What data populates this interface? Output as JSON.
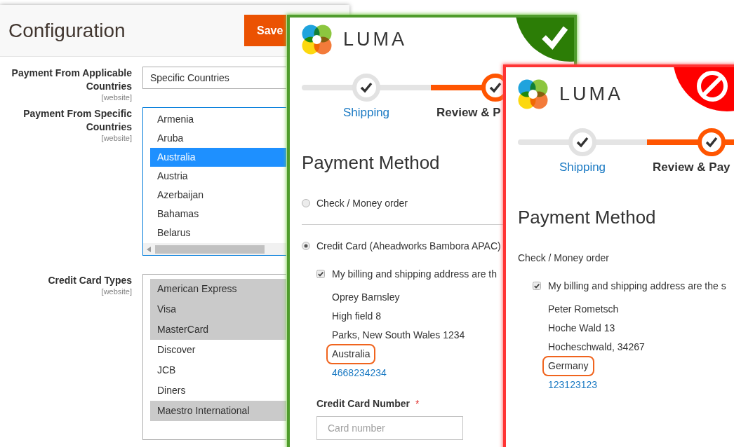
{
  "admin": {
    "title": "Configuration",
    "save_label": "Save",
    "fields": [
      {
        "kind": "select",
        "label": "Payment From Applicable Countries",
        "scope": "[website]",
        "value": "Specific Countries"
      },
      {
        "kind": "multiselect",
        "label": "Payment From Specific Countries",
        "scope": "[website]",
        "focused": true,
        "horizontal_scrollbar": true,
        "options": [
          {
            "label": "Armenia",
            "selected": false
          },
          {
            "label": "Aruba",
            "selected": false
          },
          {
            "label": "Australia",
            "selected": true
          },
          {
            "label": "Austria",
            "selected": false
          },
          {
            "label": "Azerbaijan",
            "selected": false
          },
          {
            "label": "Bahamas",
            "selected": false
          },
          {
            "label": "Belarus",
            "selected": false
          }
        ]
      },
      {
        "kind": "multiselect",
        "label": "Credit Card Types",
        "scope": "[website]",
        "focused": false,
        "options": [
          {
            "label": "American Express",
            "selected": true
          },
          {
            "label": "Visa",
            "selected": true
          },
          {
            "label": "MasterCard",
            "selected": true
          },
          {
            "label": "Discover",
            "selected": false
          },
          {
            "label": "JCB",
            "selected": false
          },
          {
            "label": "Diners",
            "selected": false
          },
          {
            "label": "Maestro International",
            "selected": true
          }
        ]
      }
    ]
  },
  "checkouts": [
    {
      "kind": "accepted",
      "brand": "LUMA",
      "steps": [
        {
          "label": "Shipping",
          "current": false
        },
        {
          "label": "Review & P",
          "current": true
        }
      ],
      "heading": "Payment Method",
      "methods": [
        {
          "kind": "radio",
          "label": "Check / Money order",
          "selected": false
        },
        {
          "kind": "radio",
          "label": "Credit Card (Aheadworks Bambora APAC)",
          "selected": true,
          "same_address": {
            "label": "My billing and shipping address are th",
            "checked": true
          },
          "address_lines": [
            "Oprey Barnsley",
            "High field 8",
            "Parks, New South Wales 1234"
          ],
          "country": {
            "text": "Australia",
            "highlighted": true
          },
          "phone": "4668234234",
          "card_number": {
            "label": "Credit Card Number",
            "required_mark": "*",
            "placeholder": "Card number"
          }
        }
      ]
    },
    {
      "kind": "rejected",
      "brand": "LUMA",
      "steps": [
        {
          "label": "Shipping",
          "current": false
        },
        {
          "label": "Review & Pay",
          "current": true
        }
      ],
      "heading": "Payment Method",
      "methods": [
        {
          "kind": "plain",
          "label": "Check / Money order",
          "same_address": {
            "label": "My billing and shipping address are the s",
            "checked": true
          },
          "address_lines": [
            "Peter Rometsch",
            "Hoche Wald 13",
            "Hocheschwald, 34267"
          ],
          "country": {
            "text": "Germany",
            "highlighted": true
          },
          "phone": "123123123"
        }
      ]
    }
  ]
}
